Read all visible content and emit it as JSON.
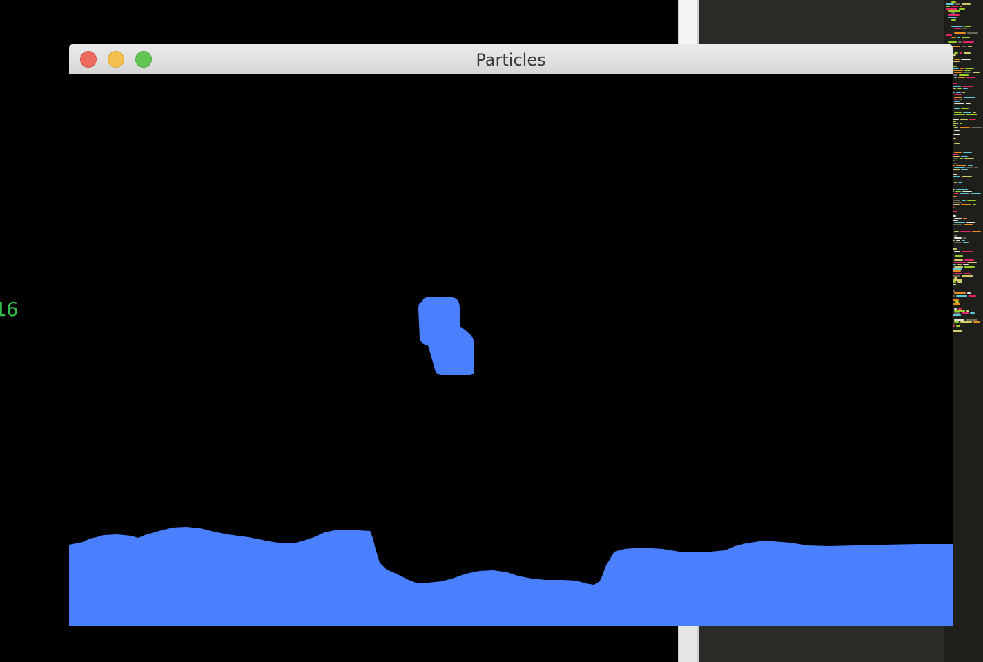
{
  "terminal": {
    "counter_text": "16"
  },
  "window": {
    "title": "Particles",
    "buttons": {
      "close": "close-window",
      "minimize": "minimize-window",
      "zoom": "zoom-window"
    }
  },
  "scene": {
    "background_color": "#000000",
    "fluid_color": "#4a7ffd"
  },
  "colors": {
    "titlebar": "#dedede",
    "close": "#ed6a5e",
    "minimize": "#f5bf4f",
    "zoom": "#61c554",
    "counter": "#2fbf4a",
    "editor_background": "#2a2b26"
  }
}
